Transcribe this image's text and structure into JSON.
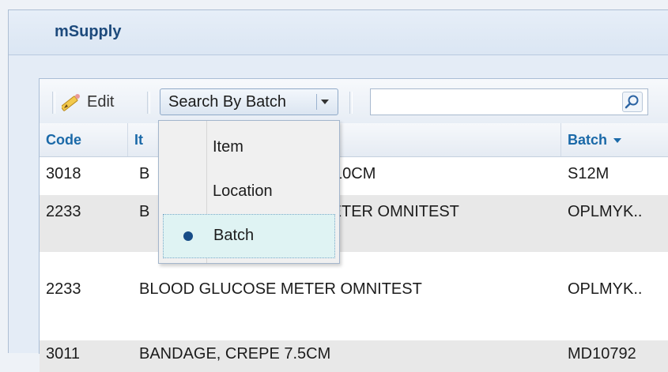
{
  "app": {
    "title": "mSupply"
  },
  "toolbar": {
    "edit_label": "Edit",
    "search_mode_label": "Search By Batch",
    "search_value": ""
  },
  "grid": {
    "columns": {
      "code": "Code",
      "item": "It",
      "batch": "Batch"
    },
    "rows": [
      {
        "code": "3018",
        "item": "B",
        "item_tail": "10CM",
        "batch": "S12M"
      },
      {
        "code": "2233",
        "item": "B",
        "item_tail": "METER OMNITEST",
        "batch": "OPLMYK.."
      },
      {
        "code": "2233",
        "item": "BLOOD GLUCOSE METER OMNITEST",
        "batch": "OPLMYK.."
      },
      {
        "code": "3011",
        "item": "BANDAGE, CREPE 7.5CM",
        "batch": "MD10792"
      }
    ]
  },
  "search_mode_menu": {
    "options": [
      "Item",
      "Location",
      "Batch"
    ],
    "selected": "Batch"
  },
  "colors": {
    "brand": "#1d4a7c",
    "header_text": "#1a69a8",
    "alt_row": "#e8e8e8",
    "selected_option": "#dff3f3"
  }
}
